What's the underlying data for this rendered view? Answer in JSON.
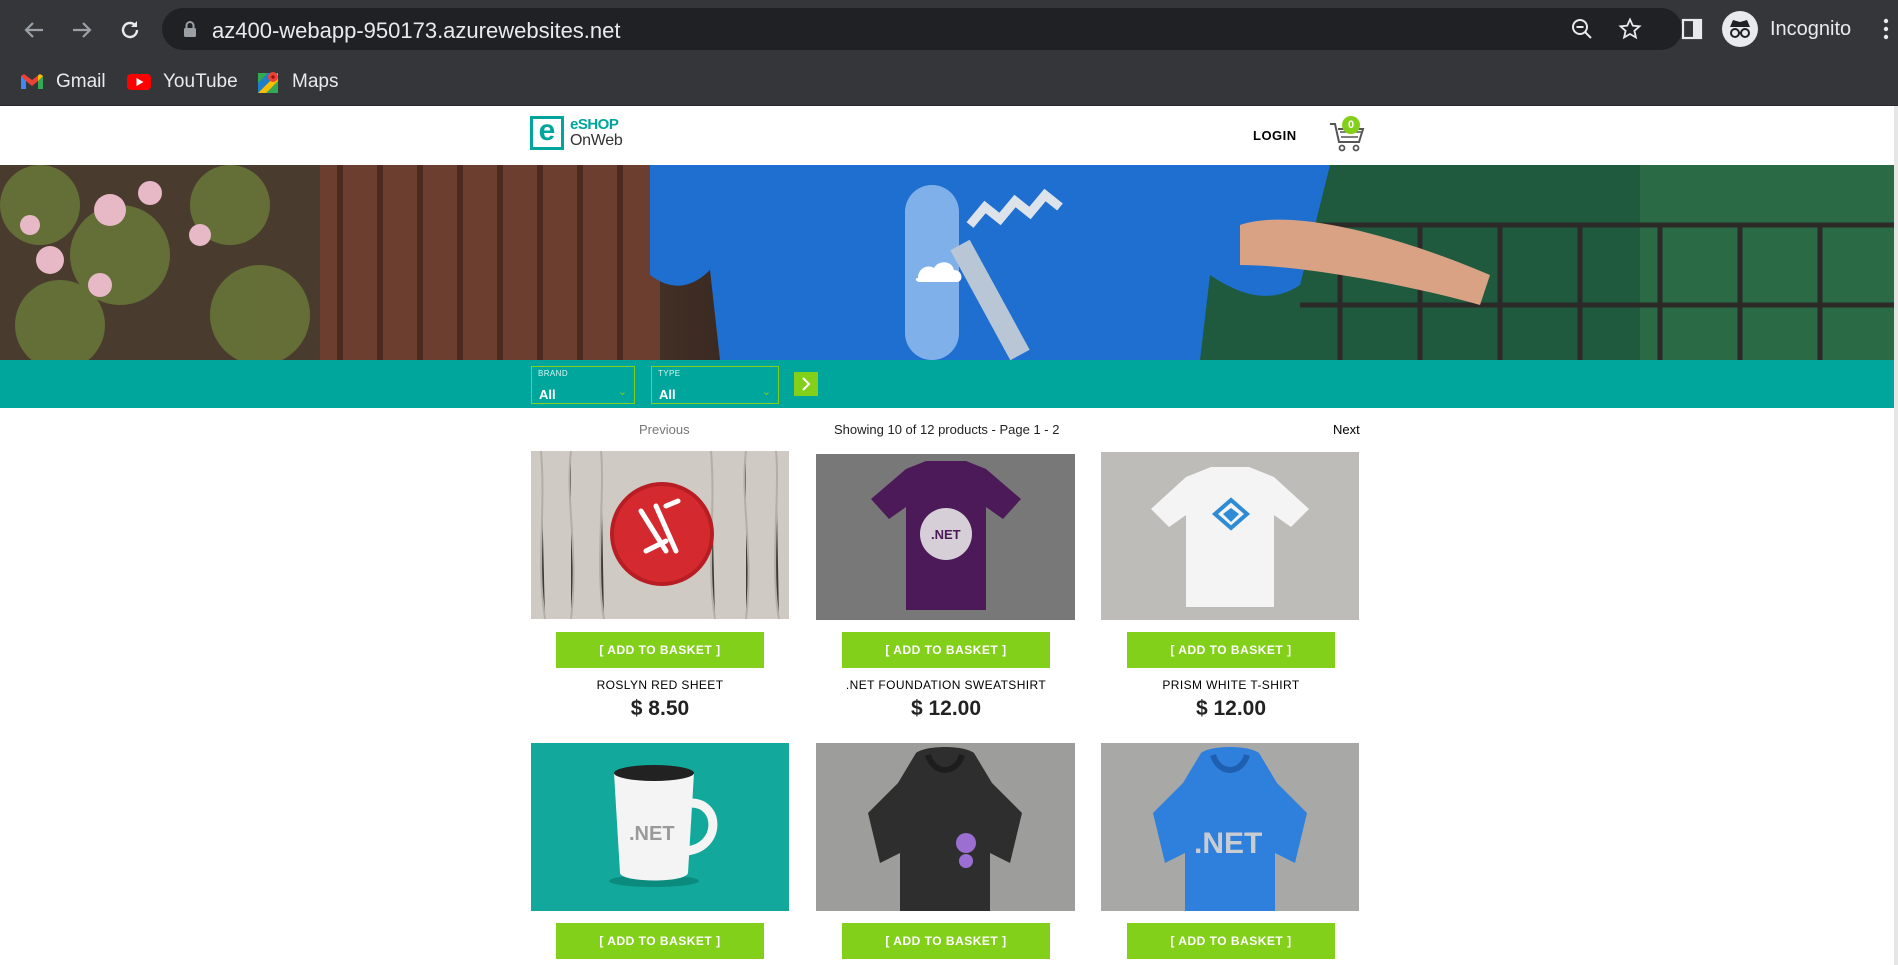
{
  "browser": {
    "url": "az400-webapp-950173.azurewebsites.net",
    "profile_label": "Incognito",
    "bookmarks": [
      {
        "label": "Gmail",
        "icon": "gmail-icon"
      },
      {
        "label": "YouTube",
        "icon": "youtube-icon"
      },
      {
        "label": "Maps",
        "icon": "maps-icon"
      }
    ]
  },
  "header": {
    "logo_line1": "eSHOP",
    "logo_line2": "OnWeb",
    "logo_letter": "e",
    "login_label": "LOGIN",
    "cart_count": "0"
  },
  "filters": {
    "brand": {
      "caption": "BRAND",
      "value": "All"
    },
    "type": {
      "caption": "TYPE",
      "value": "All"
    }
  },
  "pager": {
    "previous_label": "Previous",
    "info": "Showing 10 of 12 products - Page 1 - 2",
    "next_label": "Next"
  },
  "basket_label": "[ ADD TO BASKET ]",
  "products": [
    {
      "name": "ROSLYN RED SHEET",
      "price": "$ 8.50"
    },
    {
      "name": ".NET FOUNDATION SWEATSHIRT",
      "price": "$ 12.00"
    },
    {
      "name": "PRISM WHITE T-SHIRT",
      "price": "$ 12.00"
    },
    {
      "name": "",
      "price": ""
    },
    {
      "name": "",
      "price": ""
    },
    {
      "name": "",
      "price": ""
    }
  ],
  "image_text": {
    "sweatshirt_print": ".NET",
    "mug_print": ".NET",
    "hoodie_print": ".NET"
  },
  "colors": {
    "brand_teal": "#00a69c",
    "accent_green": "#83d01b",
    "chrome_dark": "#35363a"
  }
}
